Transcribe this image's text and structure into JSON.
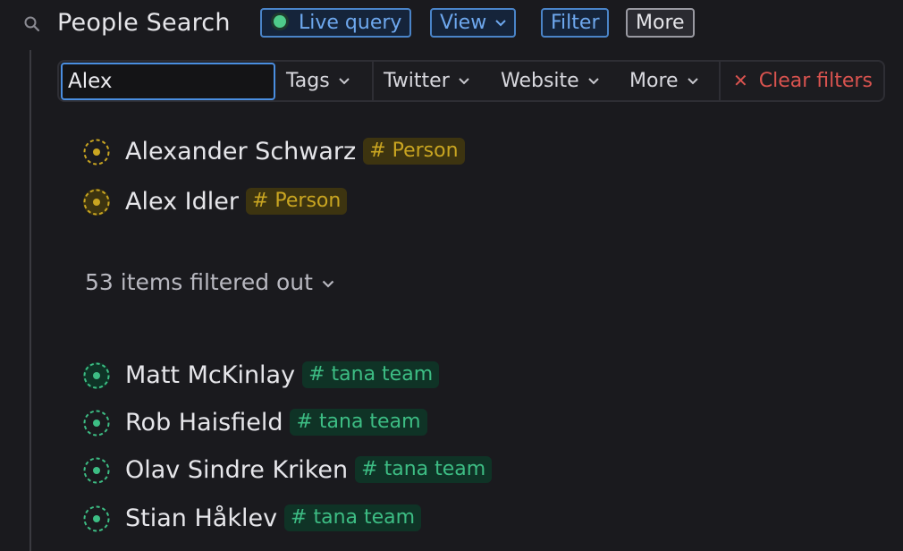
{
  "header": {
    "title": "People Search",
    "live_query_label": "Live query",
    "view_label": "View",
    "filter_label": "Filter",
    "more_label": "More"
  },
  "filter_bar": {
    "search_value": "Alex",
    "filters": [
      {
        "label": "Tags"
      },
      {
        "label": "Twitter"
      },
      {
        "label": "Website"
      },
      {
        "label": "More"
      }
    ],
    "clear_label": "Clear filters"
  },
  "results": [
    {
      "name": "Alexander Schwarz",
      "tag": "# Person"
    },
    {
      "name": "Alex Idler",
      "tag": "# Person"
    }
  ],
  "filtered_out_label": "53 items filtered out",
  "other_items": [
    {
      "name": "Matt McKinlay",
      "tag": "# tana team"
    },
    {
      "name": "Rob Haisfield",
      "tag": "# tana team"
    },
    {
      "name": "Olav Sindre Kriken",
      "tag": "# tana team"
    },
    {
      "name": "Stian Håklev",
      "tag": "# tana team"
    }
  ],
  "colors": {
    "background": "#1a1a1e",
    "accent_blue": "#6ea8ee",
    "person_tag": "#c9a521",
    "team_tag": "#3dbd84",
    "clear_red": "#d9534f",
    "live_dot": "#4ecb8a"
  },
  "icons": [
    "search-icon",
    "chevron-down-icon",
    "close-icon",
    "bullet-icon",
    "live-dot-icon"
  ]
}
